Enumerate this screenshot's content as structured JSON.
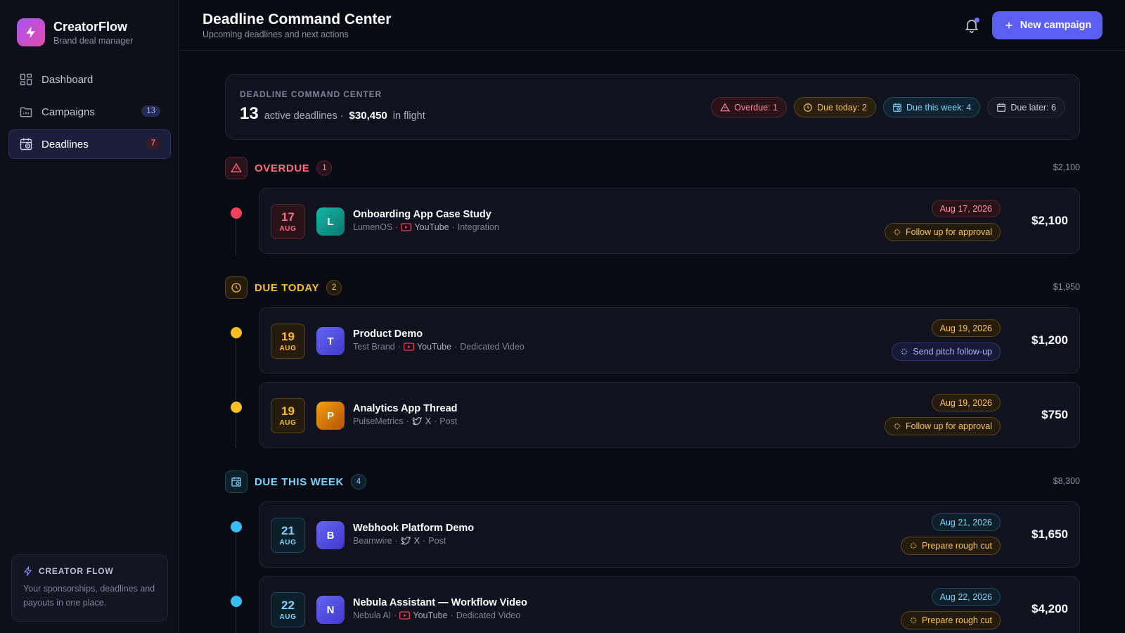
{
  "brand": {
    "name": "CreatorFlow",
    "subtitle": "Brand deal manager",
    "logo_icon": "bolt-icon",
    "accent": "#a855f7"
  },
  "nav": {
    "items": [
      {
        "label": "Dashboard",
        "icon": "dashboard-icon",
        "badge": ""
      },
      {
        "label": "Campaigns",
        "icon": "folder-icon",
        "badge": "13"
      },
      {
        "label": "Deadlines",
        "icon": "calendar-clock-icon",
        "badge": "7",
        "active": true
      }
    ]
  },
  "side_card": {
    "title": "CREATOR FLOW",
    "text": "Your sponsorships, deadlines and payouts in one place."
  },
  "header": {
    "title": "Deadline Command Center",
    "subtitle": "Upcoming deadlines and next actions",
    "new_button": "New campaign",
    "primary_color": "#5b5ef0"
  },
  "summary": {
    "label": "DEADLINE COMMAND CENTER",
    "count": "13",
    "count_text": "active deadlines ·",
    "amount": "$30,450",
    "amount_text": "in flight",
    "pills": {
      "overdue": "Overdue: 1",
      "today": "Due today: 2",
      "week": "Due this week: 4",
      "later": "Due later: 6"
    }
  },
  "sections": {
    "overdue": {
      "title": "OVERDUE",
      "count": "1",
      "total": "$2,100",
      "color": "#ff6b85",
      "rows": [
        {
          "day": "17",
          "month": "AUG",
          "avatar": "L",
          "avatar_color": "#14b8a6",
          "title": "Onboarding App Case Study",
          "brand": "LumenOS",
          "platform": "YouTube",
          "type": "Integration",
          "date": "Aug 17, 2026",
          "action": "Follow up for approval",
          "amount": "$2,100"
        }
      ]
    },
    "today": {
      "title": "DUE TODAY",
      "count": "2",
      "total": "$1,950",
      "color": "#fbbf24",
      "rows": [
        {
          "day": "19",
          "month": "AUG",
          "avatar": "T",
          "avatar_color": "#6366f1",
          "title": "Product Demo",
          "brand": "Test Brand",
          "platform": "YouTube",
          "type": "Dedicated Video",
          "date": "Aug 19, 2026",
          "action": "Send pitch follow-up",
          "amount": "$1,200"
        },
        {
          "day": "19",
          "month": "AUG",
          "avatar": "P",
          "avatar_color": "#f59e0b",
          "title": "Analytics App Thread",
          "brand": "PulseMetrics",
          "platform": "X",
          "type": "Post",
          "date": "Aug 19, 2026",
          "action": "Follow up for approval",
          "amount": "$750"
        }
      ]
    },
    "week": {
      "title": "DUE THIS WEEK",
      "count": "4",
      "total": "$8,300",
      "color": "#38bdf8",
      "rows": [
        {
          "day": "21",
          "month": "AUG",
          "avatar": "B",
          "avatar_color": "#6366f1",
          "title": "Webhook Platform Demo",
          "brand": "Beamwire",
          "platform": "X",
          "type": "Post",
          "date": "Aug 21, 2026",
          "action": "Prepare rough cut",
          "amount": "$1,650"
        },
        {
          "day": "22",
          "month": "AUG",
          "avatar": "N",
          "avatar_color": "#6366f1",
          "title": "Nebula Assistant — Workflow Video",
          "brand": "Nebula AI",
          "platform": "YouTube",
          "type": "Dedicated Video",
          "date": "Aug 22, 2026",
          "action": "Prepare rough cut",
          "amount": "$4,200"
        }
      ]
    }
  }
}
